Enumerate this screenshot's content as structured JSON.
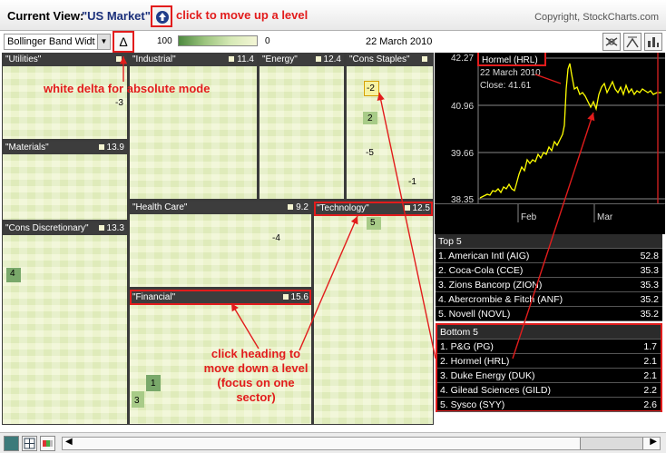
{
  "header": {
    "current_view_label": "Current View:",
    "current_view_value": "\"US Market\"",
    "copyright": "Copyright, StockCharts.com"
  },
  "toolbar": {
    "indicator_select": "Bollinger Band Widt",
    "delta_symbol": "Δ",
    "scale_high": "100",
    "scale_low": "0",
    "date": "22 March 2010"
  },
  "annotations": {
    "up_level": "click to move up a level",
    "delta": "white delta for absolute mode",
    "heading_line1": "click heading to",
    "heading_line2": "move down a level",
    "heading_line3": "(focus on one sector)"
  },
  "sectors": {
    "utilities": {
      "name": "\"Utilities\"",
      "value": ""
    },
    "materials": {
      "name": "\"Materials\"",
      "value": "13.9"
    },
    "cons_discretionary": {
      "name": "\"Cons Discretionary\"",
      "value": "13.3"
    },
    "industrial": {
      "name": "\"Industrial\"",
      "value": "11.4"
    },
    "energy": {
      "name": "\"Energy\"",
      "value": "12.4"
    },
    "cons_staples": {
      "name": "\"Cons Staples\"",
      "value": ""
    },
    "health_care": {
      "name": "\"Health Care\"",
      "value": "9.2"
    },
    "technology": {
      "name": "\"Technology\"",
      "value": "12.5"
    },
    "financial": {
      "name": "\"Financial\"",
      "value": "15.6"
    }
  },
  "cell_labels": {
    "util_a": "-3",
    "cs_a": "-2",
    "cs_b": "2",
    "cs_c": "-5",
    "cs_d": "-1",
    "hc_a": "-4",
    "tech_a": "5",
    "cd_a": "4",
    "fin_a": "1",
    "fin_b": "3"
  },
  "stock_chart": {
    "title": "Hormel (HRL)",
    "date": "22 March 2010",
    "close": "Close: 41.61",
    "y_ticks": [
      "42.27",
      "40.96",
      "39.66",
      "38.35"
    ],
    "x_ticks": [
      "Feb",
      "Mar"
    ]
  },
  "top5": {
    "title": "Top 5",
    "rows": [
      {
        "name": "1. American Intl (AIG)",
        "value": "52.8"
      },
      {
        "name": "2. Coca-Cola (CCE)",
        "value": "35.3"
      },
      {
        "name": "3. Zions Bancorp (ZION)",
        "value": "35.3"
      },
      {
        "name": "4. Abercrombie & Fitch (ANF)",
        "value": "35.2"
      },
      {
        "name": "5. Novell (NOVL)",
        "value": "35.2"
      }
    ]
  },
  "bottom5": {
    "title": "Bottom 5",
    "rows": [
      {
        "name": "1. P&G (PG)",
        "value": "1.7"
      },
      {
        "name": "2. Hormel (HRL)",
        "value": "2.1"
      },
      {
        "name": "3. Duke Energy (DUK)",
        "value": "2.1"
      },
      {
        "name": "4. Gilead Sciences (GILD)",
        "value": "2.2"
      },
      {
        "name": "5. Sysco (SYY)",
        "value": "2.6"
      }
    ]
  },
  "colors": {
    "annotation_red": "#e21c1c",
    "header_dark": "#3d3d3d",
    "tile_light": "#eaf2c6",
    "tile_dark": "#79a86a",
    "price_line": "#ffff00"
  }
}
